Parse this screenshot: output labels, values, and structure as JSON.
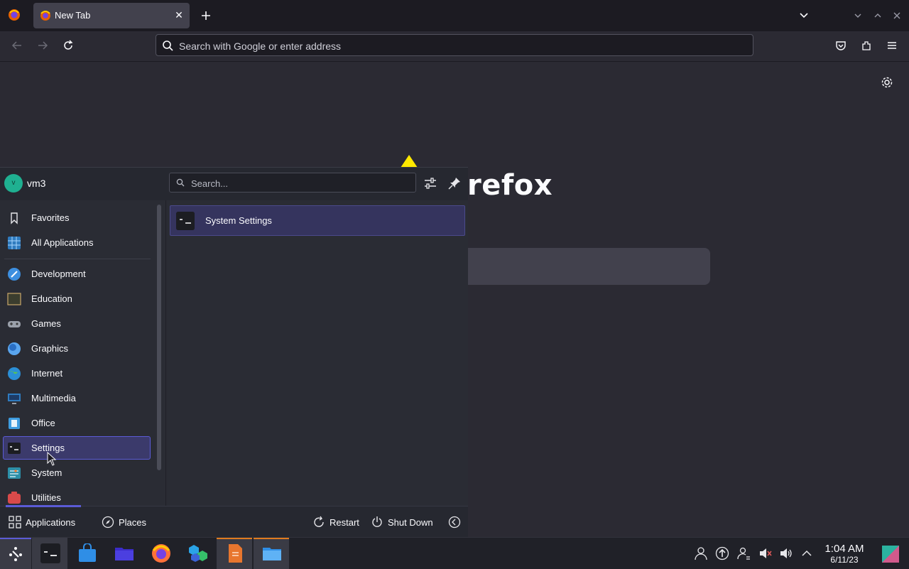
{
  "browser": {
    "tab_title": "New Tab",
    "url_placeholder": "Search with Google or enter address"
  },
  "newtab": {
    "brand_text": "refox"
  },
  "launcher": {
    "username": "vm3",
    "avatar_letter": "v",
    "search_placeholder": "Search...",
    "categories": [
      {
        "label": "Favorites",
        "icon": "bookmark-icon"
      },
      {
        "label": "All Applications",
        "icon": "grid-apps-icon"
      },
      {
        "label": "Development",
        "icon": "development-icon"
      },
      {
        "label": "Education",
        "icon": "education-icon"
      },
      {
        "label": "Games",
        "icon": "gamepad-icon"
      },
      {
        "label": "Graphics",
        "icon": "graphics-icon"
      },
      {
        "label": "Internet",
        "icon": "globe-icon"
      },
      {
        "label": "Multimedia",
        "icon": "multimedia-icon"
      },
      {
        "label": "Office",
        "icon": "office-icon"
      },
      {
        "label": "Settings",
        "icon": "settings-icon",
        "selected": true
      },
      {
        "label": "System",
        "icon": "system-icon"
      },
      {
        "label": "Utilities",
        "icon": "utilities-icon"
      }
    ],
    "results": [
      {
        "label": "System Settings",
        "icon": "system-settings-icon"
      }
    ],
    "footer": {
      "applications": "Applications",
      "places": "Places",
      "restart": "Restart",
      "shutdown": "Shut Down"
    }
  },
  "taskbar": {
    "clock_time": "1:04 AM",
    "clock_date": "6/11/23"
  },
  "colors": {
    "accent": "#5b5bd6",
    "selection": "#3b3a6b",
    "taskbar_indicator": "#e07b1f"
  }
}
